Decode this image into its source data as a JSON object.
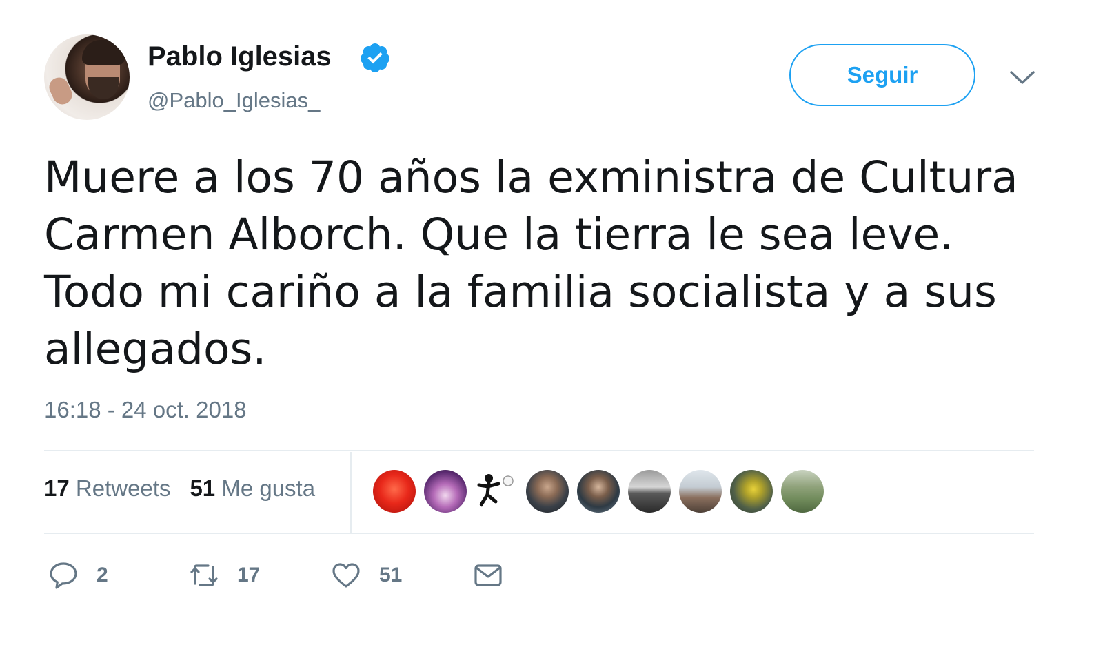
{
  "author": {
    "name": "Pablo Iglesias",
    "handle": "@Pablo_Iglesias_",
    "verified": true
  },
  "follow_button": {
    "label": "Seguir"
  },
  "tweet": {
    "lines": [
      "Muere a los 70 años la exministra de Cultura",
      "Carmen Alborch. Que la tierra le sea leve.",
      "Todo mi cariño a la familia socialista y a sus",
      "allegados."
    ],
    "timestamp": "16:18 - 24 oct. 2018"
  },
  "stats": {
    "retweets_count": "17",
    "retweets_label": "Retweets",
    "likes_count": "51",
    "likes_label": "Me gusta"
  },
  "likers": [
    {
      "icon": "liker-avatar-red"
    },
    {
      "icon": "liker-avatar-purple-cartoon"
    },
    {
      "icon": "liker-avatar-football-kick"
    },
    {
      "icon": "liker-avatar-man"
    },
    {
      "icon": "liker-avatar-man-glasses"
    },
    {
      "icon": "liker-avatar-landscape-gray"
    },
    {
      "icon": "liker-avatar-building"
    },
    {
      "icon": "liker-avatar-yellow-figure"
    },
    {
      "icon": "liker-avatar-green-field"
    }
  ],
  "actions": {
    "reply_count": "2",
    "retweet_count": "17",
    "like_count": "51"
  },
  "colors": {
    "accent": "#1da1f2",
    "verified": "#1da1f2",
    "muted_text": "#657786",
    "text": "#14171a",
    "divider": "#e6ecf0"
  }
}
